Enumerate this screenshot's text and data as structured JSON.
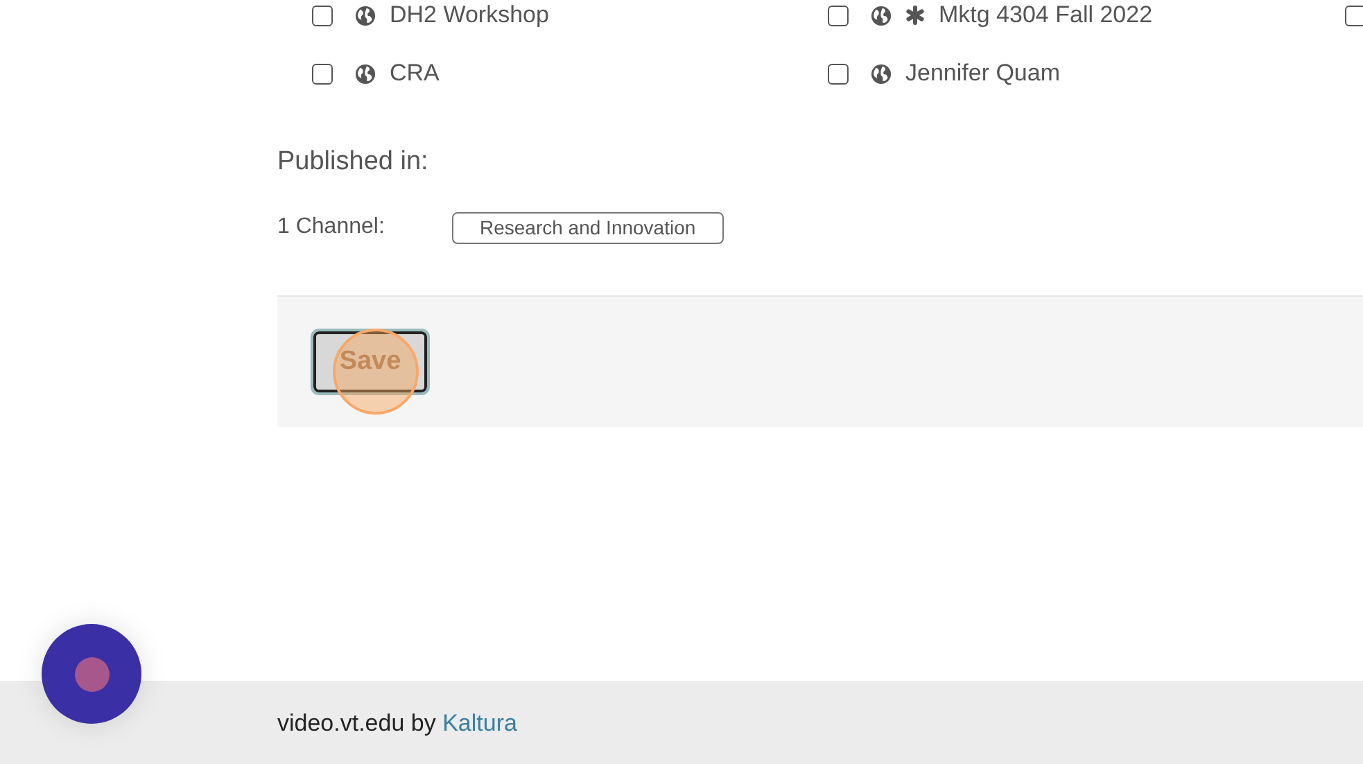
{
  "categories": [
    {
      "label": "DH2 Workshop",
      "checked": false,
      "public": true,
      "asterisk": false
    },
    {
      "label": "Mktg 4304 Fall 2022",
      "checked": false,
      "public": true,
      "asterisk": true
    },
    {
      "checked": false
    },
    {
      "label": "CRA",
      "checked": false,
      "public": true,
      "asterisk": false
    },
    {
      "label": "Jennifer Quam",
      "checked": false,
      "public": true,
      "asterisk": false
    }
  ],
  "published": {
    "heading": "Published in:",
    "channel_label": "1 Channel:",
    "channels": [
      "Research and Innovation"
    ]
  },
  "save_button": {
    "label": "Save"
  },
  "footer": {
    "text": "video.vt.edu by",
    "link": "Kaltura"
  }
}
